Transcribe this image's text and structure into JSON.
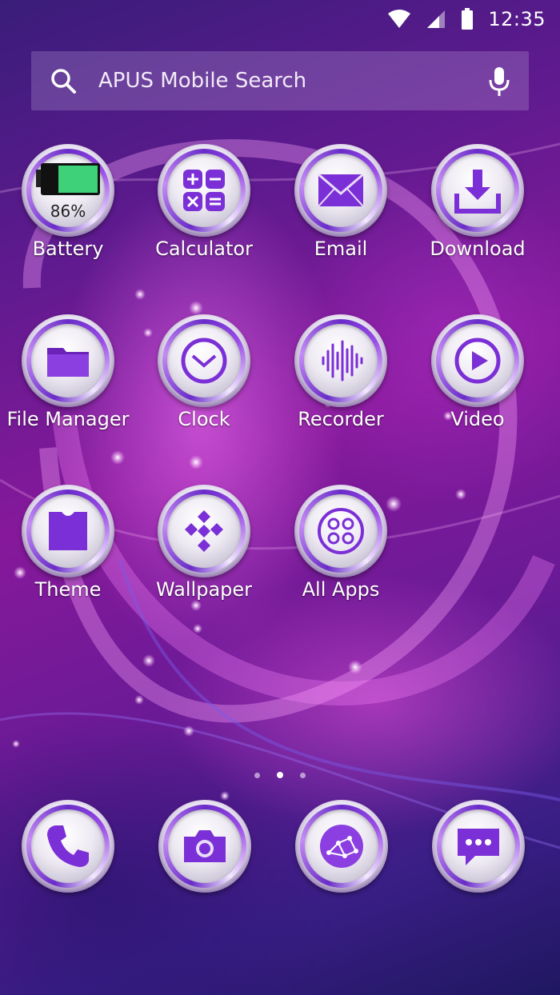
{
  "status_bar": {
    "time": "12:35",
    "icons": [
      "wifi-icon",
      "cell-signal-icon",
      "battery-icon"
    ]
  },
  "search": {
    "placeholder": "APUS Mobile Search",
    "icons": [
      "search-icon",
      "mic-icon"
    ]
  },
  "apps": [
    {
      "label": "Battery",
      "icon": "battery-icon",
      "battery_level": "86%"
    },
    {
      "label": "Calculator",
      "icon": "calculator-icon"
    },
    {
      "label": "Email",
      "icon": "envelope-icon"
    },
    {
      "label": "Download",
      "icon": "download-icon"
    },
    {
      "label": "File Manager",
      "icon": "folder-icon"
    },
    {
      "label": "Clock",
      "icon": "clock-icon"
    },
    {
      "label": "Recorder",
      "icon": "sound-wave-icon"
    },
    {
      "label": "Video",
      "icon": "play-icon"
    },
    {
      "label": "Theme",
      "icon": "shirt-icon"
    },
    {
      "label": "Wallpaper",
      "icon": "diamond-pattern-icon"
    },
    {
      "label": "All Apps",
      "icon": "app-grid-icon"
    }
  ],
  "page_indicator": {
    "count": 3,
    "active_index": 1
  },
  "dock": [
    {
      "icon": "phone-icon"
    },
    {
      "icon": "camera-icon"
    },
    {
      "icon": "browser-network-icon"
    },
    {
      "icon": "message-icon"
    }
  ],
  "colors": {
    "accent_purple": "#7b2fd6",
    "background_magenta": "#86199b",
    "battery_green": "#3fd07a"
  }
}
